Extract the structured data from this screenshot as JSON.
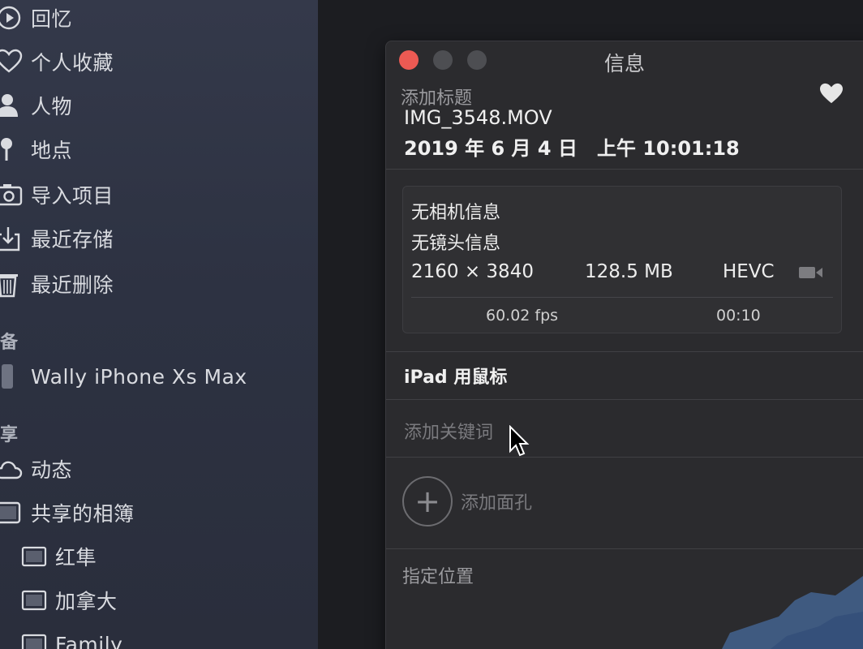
{
  "sidebar": {
    "items": [
      {
        "label": "回忆",
        "icon": "memories-icon"
      },
      {
        "label": "个人收藏",
        "icon": "heart-icon"
      },
      {
        "label": "人物",
        "icon": "person-icon"
      },
      {
        "label": "地点",
        "icon": "pin-icon"
      },
      {
        "label": "导入项目",
        "icon": "camera-icon"
      },
      {
        "label": "最近存储",
        "icon": "download-icon"
      },
      {
        "label": "最近删除",
        "icon": "trash-icon"
      }
    ],
    "devices_header": "备",
    "device": {
      "label": "Wally iPhone Xs Max",
      "icon": "phone-icon"
    },
    "shared_header": "享",
    "shared_items": [
      {
        "label": "动态",
        "icon": "cloud-icon"
      },
      {
        "label": "共享的相簿",
        "icon": "shared-albums-icon"
      }
    ],
    "albums": [
      {
        "label": "红隼",
        "icon": "album-icon"
      },
      {
        "label": "加拿大",
        "icon": "album-icon"
      },
      {
        "label": "Family",
        "icon": "album-icon"
      }
    ]
  },
  "info_panel": {
    "window_title": "信息",
    "add_title_placeholder": "添加标题",
    "filename": "IMG_3548.MOV",
    "date": "2019 年 6 月 4 日",
    "time": "上午 10:01:18",
    "camera_info": "无相机信息",
    "lens_info": "无镜头信息",
    "dimensions": "2160 × 3840",
    "size": "128.5 MB",
    "codec": "HEVC",
    "fps": "60.02 fps",
    "duration": "00:10",
    "caption": "iPad 用鼠标",
    "keywords_placeholder": "添加关键词",
    "add_faces_label": "添加面孔",
    "location_label": "指定位置"
  },
  "colors": {
    "close_button": "#ec5a53",
    "panel_bg": "#2b2b2e",
    "sidebar_bg": "#2d3242"
  }
}
